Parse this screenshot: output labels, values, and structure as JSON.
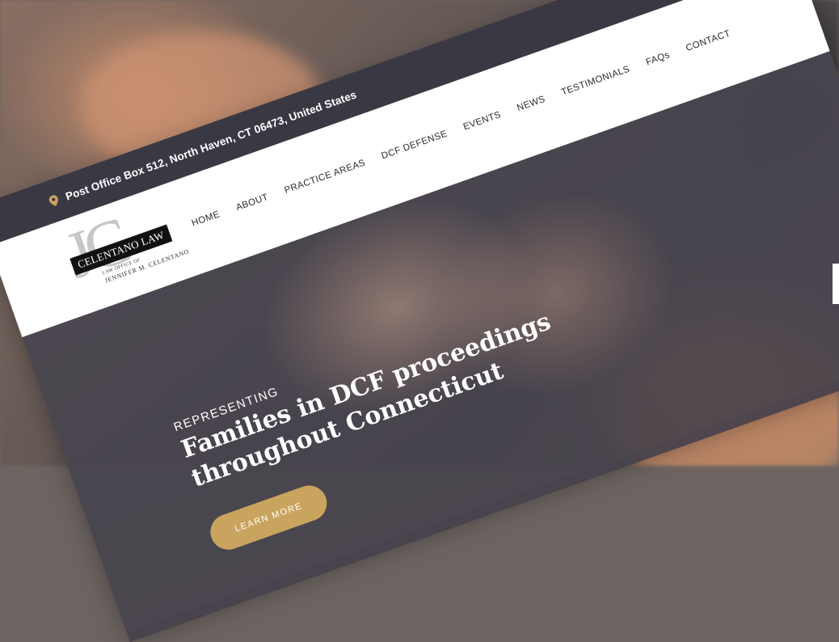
{
  "topbar": {
    "address": "Post Office Box 512, North Haven, CT 06473, United States",
    "icon": "map-pin-icon",
    "icon_color": "#c9a45f"
  },
  "logo": {
    "monogram": "JC",
    "badge": "CELENTANO LAW",
    "sub_line1": "LAW OFFICE OF",
    "sub_line2": "JENNIFER M. CELENTANO"
  },
  "nav": {
    "items": [
      {
        "label": "HOME"
      },
      {
        "label": "ABOUT"
      },
      {
        "label": "PRACTICE AREAS"
      },
      {
        "label": "DCF DEFENSE"
      },
      {
        "label": "EVENTS"
      },
      {
        "label": "NEWS"
      },
      {
        "label": "TESTIMONIALS"
      },
      {
        "label": "FAQs"
      },
      {
        "label": "CONTACT"
      }
    ]
  },
  "hero": {
    "kicker": "REPRESENTING",
    "headline": "Families in DCF proceedings throughout Connecticut",
    "cta": "LEARN MORE"
  },
  "colors": {
    "topbar": "#3a3943",
    "accent": "#c9a45f",
    "header": "#ffffff"
  }
}
